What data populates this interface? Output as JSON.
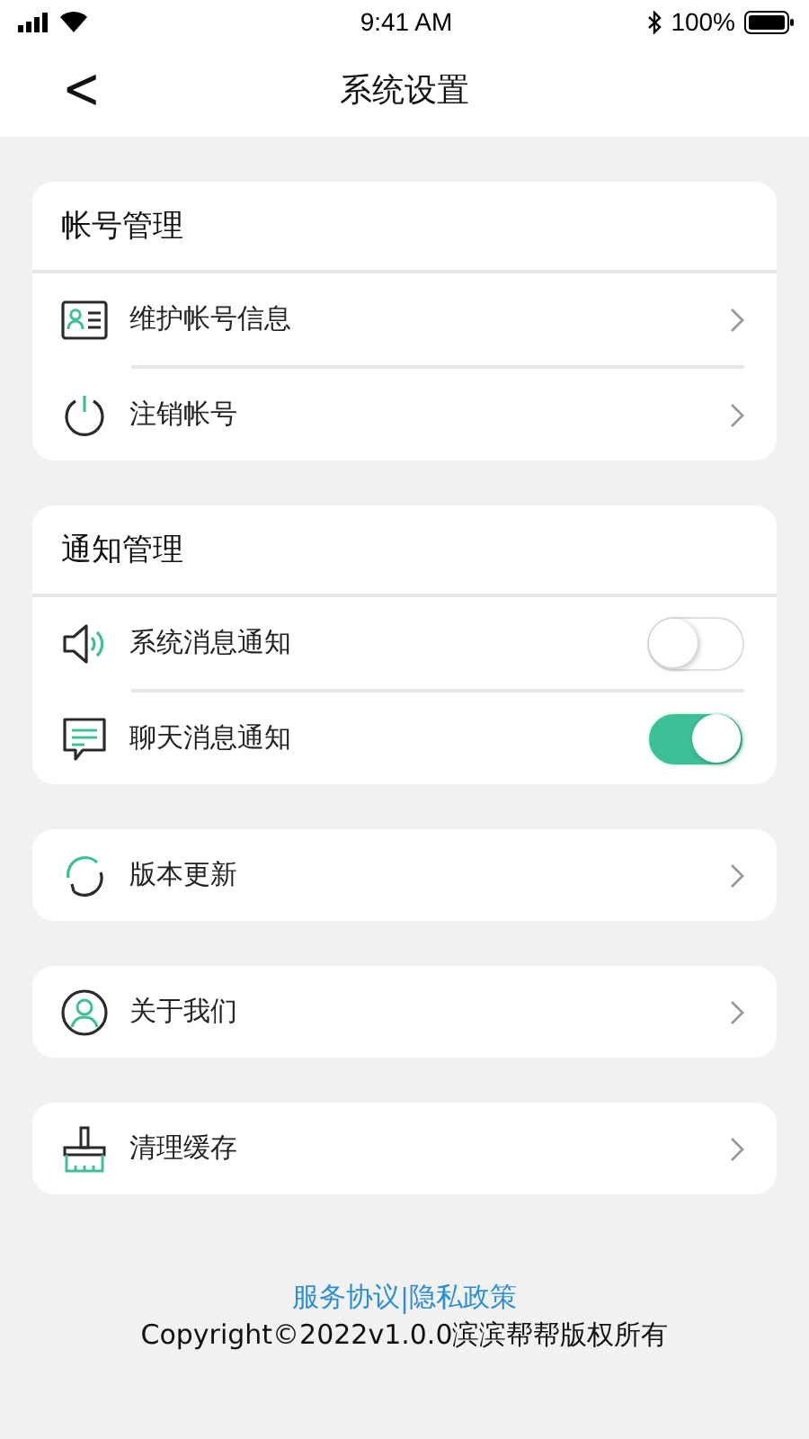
{
  "status_bar": {
    "time": "9:41 AM",
    "battery": "100%"
  },
  "nav": {
    "back": "<",
    "title": "系统设置"
  },
  "groups": [
    {
      "header": "帐号管理",
      "items": [
        {
          "kind": "link",
          "label": "维护帐号信息"
        },
        {
          "kind": "link",
          "label": "注销帐号"
        }
      ]
    },
    {
      "header": "通知管理",
      "items": [
        {
          "kind": "toggle",
          "label": "系统消息通知",
          "on": false
        },
        {
          "kind": "toggle",
          "label": "聊天消息通知",
          "on": true
        }
      ]
    },
    {
      "items": [
        {
          "kind": "link",
          "label": "版本更新"
        }
      ]
    },
    {
      "items": [
        {
          "kind": "link",
          "label": "关于我们"
        }
      ]
    },
    {
      "items": [
        {
          "kind": "link",
          "label": "清理缓存"
        }
      ]
    }
  ],
  "footer": {
    "links": [
      "服务协议",
      "隐私政策"
    ],
    "separator": "|",
    "copyright": "Copyright©2022v1.0.0滨滨帮帮版权所有"
  }
}
